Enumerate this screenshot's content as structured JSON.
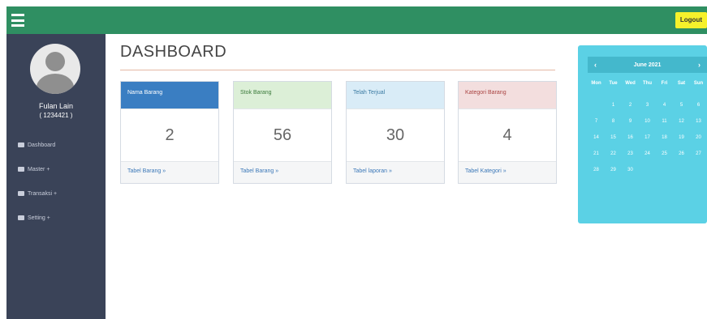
{
  "topbar": {
    "logout_label": "Logout",
    "color": "#2f8f62"
  },
  "sidebar": {
    "user_name": "Fulan Lain",
    "user_id": "( 1234421 )",
    "menu": [
      {
        "label": "Dashboard",
        "icon": "dashboard-icon"
      },
      {
        "label": "Master +",
        "icon": "list-icon"
      },
      {
        "label": "Transaksi +",
        "icon": "desktop-icon"
      },
      {
        "label": "Setting +",
        "icon": "gear-icon"
      }
    ]
  },
  "main": {
    "title": "DASHBOARD",
    "cards": [
      {
        "header": "Nama Barang",
        "value": "2",
        "footer": "Tabel Barang »"
      },
      {
        "header": "Stok Barang",
        "value": "56",
        "footer": "Tabel Barang »"
      },
      {
        "header": "Telah Terjual",
        "value": "30",
        "footer": "Tabel laporan »"
      },
      {
        "header": "Kategori Barang",
        "value": "4",
        "footer": "Tabel Kategori »"
      }
    ]
  },
  "calendar": {
    "month": "June 2021",
    "prev": "‹",
    "next": "›",
    "weekdays": [
      "Mon",
      "Tue",
      "Wed",
      "Thu",
      "Fri",
      "Sat",
      "Sun"
    ],
    "days": [
      "",
      "1",
      "2",
      "3",
      "4",
      "5",
      "6",
      "7",
      "8",
      "9",
      "10",
      "11",
      "12",
      "13",
      "14",
      "15",
      "16",
      "17",
      "18",
      "19",
      "20",
      "21",
      "22",
      "23",
      "24",
      "25",
      "26",
      "27",
      "28",
      "29",
      "30"
    ]
  }
}
